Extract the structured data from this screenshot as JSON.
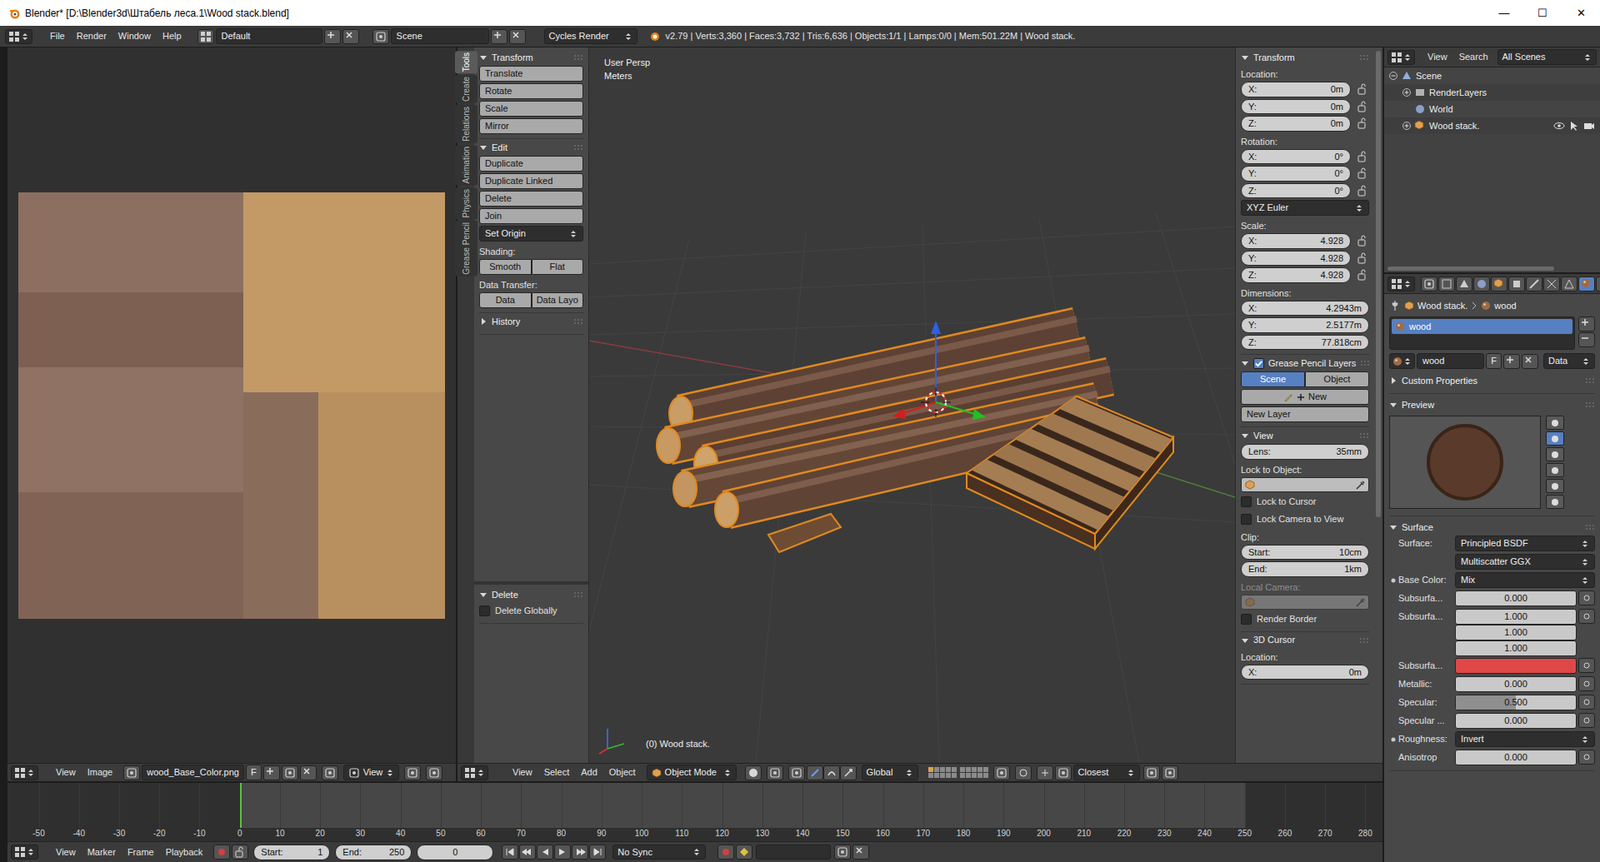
{
  "window": {
    "title": "Blender* [D:\\Blender3d\\Штабель леса.1\\Wood stack.blend]",
    "controls": [
      "—",
      "☐",
      "✕"
    ]
  },
  "info_header": {
    "menus": [
      "File",
      "Render",
      "Window",
      "Help"
    ],
    "layout": "Default",
    "scene": "Scene",
    "engine": "Cycles Render",
    "stats": "v2.79 | Verts:3,360 | Faces:3,732 | Tris:6,636 | Objects:1/1 | Lamps:0/0 | Mem:501.22M | Wood stack."
  },
  "image_editor": {
    "menus": [
      "View",
      "Image"
    ],
    "image": "wood_Base_Color.png",
    "fake_user": "F",
    "view": "View"
  },
  "tool_tabs": [
    {
      "label": "Tools",
      "selected": true
    },
    {
      "label": "Create",
      "selected": false
    },
    {
      "label": "Relations",
      "selected": false
    },
    {
      "label": "Animation",
      "selected": false
    },
    {
      "label": "Physics",
      "selected": false
    },
    {
      "label": "Grease Pencil",
      "selected": false
    }
  ],
  "tool_panel": {
    "sections": [
      {
        "title": "Transform",
        "expanded": true,
        "rows": [
          {
            "kind": "button",
            "label": "Translate"
          },
          {
            "kind": "button",
            "label": "Rotate"
          },
          {
            "kind": "button",
            "label": "Scale"
          },
          {
            "kind": "button",
            "label": "Mirror"
          }
        ]
      },
      {
        "title": "Edit",
        "expanded": true,
        "rows": [
          {
            "kind": "button",
            "label": "Duplicate"
          },
          {
            "kind": "button",
            "label": "Duplicate Linked"
          },
          {
            "kind": "button",
            "label": "Delete"
          },
          {
            "kind": "button",
            "label": "Join"
          },
          {
            "kind": "dropdown",
            "label": "Set Origin"
          },
          {
            "kind": "label",
            "label": "Shading:"
          },
          {
            "kind": "pair",
            "items": [
              {
                "label": "Smooth",
                "selected": false
              },
              {
                "label": "Flat",
                "selected": false
              }
            ]
          },
          {
            "kind": "label",
            "label": "Data Transfer:"
          },
          {
            "kind": "pair",
            "items": [
              {
                "label": "Data",
                "selected": false
              },
              {
                "label": "Data Layo",
                "selected": false
              }
            ]
          }
        ]
      },
      {
        "title": "History",
        "expanded": false,
        "rows": []
      }
    ]
  },
  "operator_panel": {
    "title": "Delete",
    "expanded": true,
    "rows": [
      {
        "kind": "checkbox",
        "label": "Delete Globally",
        "checked": false
      }
    ]
  },
  "viewport": {
    "view": "User Persp",
    "units": "Meters",
    "object": "(0) Wood stack.",
    "menus": [
      "View",
      "Select",
      "Add",
      "Object"
    ],
    "mode": "Object Mode",
    "orientation": "Global",
    "snap": "Closest"
  },
  "n_panel": {
    "sections": [
      {
        "title": "Transform",
        "expanded": true,
        "rows": [
          {
            "kind": "label",
            "label": "Location:"
          },
          {
            "kind": "field",
            "label": "X:",
            "value": "0m",
            "locked": false
          },
          {
            "kind": "field",
            "label": "Y:",
            "value": "0m",
            "locked": false
          },
          {
            "kind": "field",
            "label": "Z:",
            "value": "0m",
            "locked": false
          },
          {
            "kind": "label",
            "label": "Rotation:"
          },
          {
            "kind": "field",
            "label": "X:",
            "value": "0°",
            "locked": false
          },
          {
            "kind": "field",
            "label": "Y:",
            "value": "0°",
            "locked": false
          },
          {
            "kind": "field",
            "label": "Z:",
            "value": "0°",
            "locked": false
          },
          {
            "kind": "dropdown",
            "label": "XYZ Euler"
          },
          {
            "kind": "label",
            "label": "Scale:"
          },
          {
            "kind": "field",
            "label": "X:",
            "value": "4.928",
            "locked": false
          },
          {
            "kind": "field",
            "label": "Y:",
            "value": "4.928",
            "locked": false
          },
          {
            "kind": "field",
            "label": "Z:",
            "value": "4.928",
            "locked": false
          },
          {
            "kind": "label",
            "label": "Dimensions:"
          },
          {
            "kind": "field",
            "label": "X:",
            "value": "4.2943m"
          },
          {
            "kind": "field",
            "label": "Y:",
            "value": "2.5177m"
          },
          {
            "kind": "field",
            "label": "Z:",
            "value": "77.818cm"
          }
        ]
      },
      {
        "title": "Grease Pencil Layers",
        "expanded": true,
        "checked": true,
        "rows": [
          {
            "kind": "pair",
            "items": [
              {
                "label": "Scene",
                "selected": true
              },
              {
                "label": "Object",
                "selected": false
              }
            ]
          },
          {
            "kind": "new",
            "label": "New"
          },
          {
            "kind": "button",
            "label": "New Layer"
          }
        ]
      },
      {
        "title": "View",
        "expanded": true,
        "rows": [
          {
            "kind": "field",
            "label": "Lens:",
            "value": "35mm"
          },
          {
            "kind": "label",
            "label": "Lock to Object:"
          },
          {
            "kind": "picker",
            "disabled": false
          },
          {
            "kind": "checkbox",
            "label": "Lock to Cursor",
            "checked": false
          },
          {
            "kind": "checkbox",
            "label": "Lock Camera to View",
            "checked": false
          },
          {
            "kind": "label",
            "label": "Clip:"
          },
          {
            "kind": "field",
            "label": "Start:",
            "value": "10cm"
          },
          {
            "kind": "field",
            "label": "End:",
            "value": "1km"
          },
          {
            "kind": "label",
            "label": "Local Camera:",
            "disabled": true
          },
          {
            "kind": "picker",
            "disabled": true
          },
          {
            "kind": "checkbox",
            "label": "Render Border",
            "checked": false
          }
        ]
      },
      {
        "title": "3D Cursor",
        "expanded": true,
        "rows": [
          {
            "kind": "label",
            "label": "Location:"
          },
          {
            "kind": "field",
            "label": "X:",
            "value": "0m"
          }
        ]
      }
    ]
  },
  "outliner": {
    "menus": [
      "View",
      "Search"
    ],
    "filter": "All Scenes",
    "tree": [
      {
        "label": "Scene",
        "expanded": true,
        "children": [
          {
            "label": "RenderLayers",
            "expanded": false,
            "children": []
          },
          {
            "label": "World",
            "children": []
          },
          {
            "label": "Wood stack.",
            "expanded": false,
            "visible": true,
            "selectable": true,
            "renderable": true,
            "children": []
          }
        ]
      }
    ]
  },
  "properties": {
    "tabs": [
      {
        "selected": false
      },
      {
        "selected": false
      },
      {
        "selected": false
      },
      {
        "selected": false
      },
      {
        "selected": false
      },
      {
        "selected": false
      },
      {
        "selected": false
      },
      {
        "selected": false
      },
      {
        "selected": false
      },
      {
        "selected": true
      },
      {
        "selected": false
      }
    ],
    "breadcrumb": [
      "Wood stack.",
      "wood"
    ],
    "slots": [
      {
        "label": "wood",
        "selected": true
      }
    ],
    "datablock": {
      "name": "wood",
      "fake_user": "F",
      "link": "Data"
    },
    "sections": [
      {
        "title": "Custom Properties",
        "expanded": false,
        "rows": []
      },
      {
        "title": "Preview",
        "expanded": true,
        "rows": [
          {
            "kind": "preview",
            "shapes": [
              {
                "selected": false
              },
              {
                "selected": true
              },
              {
                "selected": false
              },
              {
                "selected": false
              },
              {
                "selected": false
              },
              {
                "selected": false
              }
            ]
          }
        ]
      },
      {
        "title": "Surface",
        "expanded": true,
        "rows": [
          {
            "kind": "select",
            "label": "Surface:",
            "value": "Principled BSDF",
            "linked": false
          },
          {
            "kind": "select",
            "value": "Multiscatter GGX",
            "linked": false
          },
          {
            "kind": "select",
            "label": "Base Color:",
            "value": "Mix",
            "linked": true
          },
          {
            "kind": "slider",
            "label": "Subsurfa...",
            "value": "0.000",
            "level": 0,
            "linked": false
          },
          {
            "kind": "vector",
            "label": "Subsurfa...",
            "values": [
              "1.000",
              "1.000",
              "1.000"
            ],
            "linked": false
          },
          {
            "kind": "color",
            "label": "Subsurfa...",
            "color": "#e04848",
            "linked": false
          },
          {
            "kind": "slider",
            "label": "Metallic:",
            "value": "0.000",
            "level": 0,
            "linked": false
          },
          {
            "kind": "slider",
            "label": "Specular:",
            "value": "0.500",
            "level": 0.5,
            "linked": false
          },
          {
            "kind": "slider",
            "label": "Specular ...",
            "value": "0.000",
            "level": 0,
            "linked": false
          },
          {
            "kind": "select",
            "label": "Roughness:",
            "value": "Invert",
            "linked": true
          },
          {
            "kind": "slider",
            "label": "Anisotrop",
            "value": "0.000",
            "level": 0,
            "linked": false
          }
        ]
      }
    ]
  },
  "timeline": {
    "menus": [
      "View",
      "Marker",
      "Frame",
      "Playback"
    ],
    "start_label": "Start:",
    "start": "1",
    "end_label": "End:",
    "end": "250",
    "current": "0",
    "sync": "No Sync",
    "ticks": [
      "-50",
      "-40",
      "-30",
      "-20",
      "-10",
      "0",
      "10",
      "20",
      "30",
      "40",
      "50",
      "60",
      "70",
      "80",
      "90",
      "100",
      "110",
      "120",
      "130",
      "140",
      "150",
      "160",
      "170",
      "180",
      "190",
      "200",
      "210",
      "220",
      "230",
      "240",
      "250",
      "260",
      "270",
      "280"
    ]
  }
}
